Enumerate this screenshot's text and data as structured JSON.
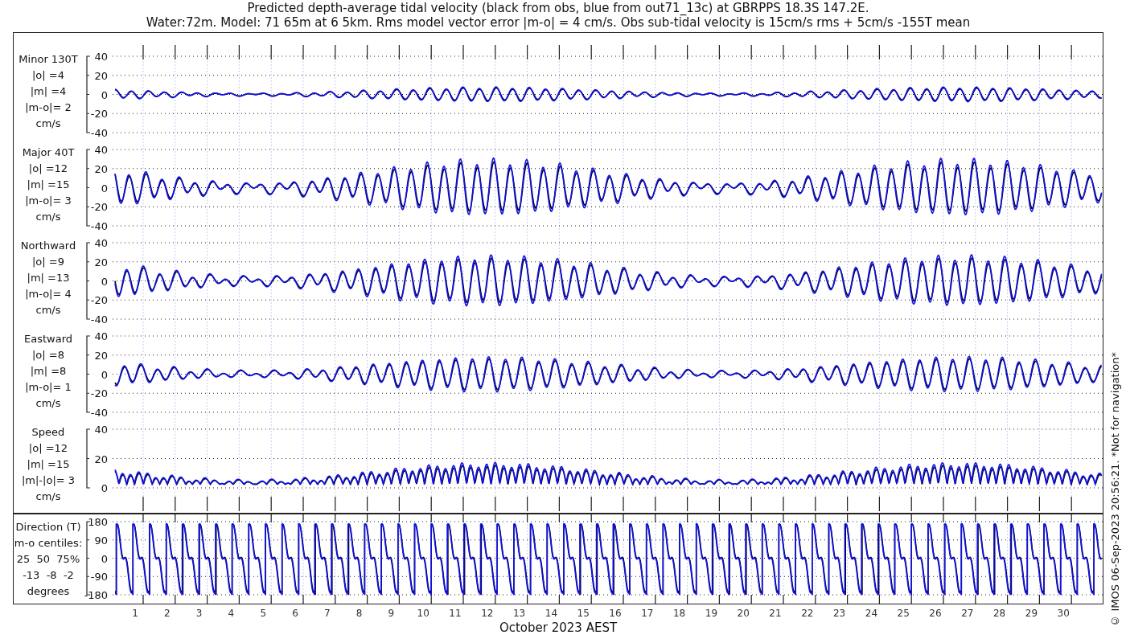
{
  "title": [
    "Predicted depth-average tidal velocity (black from obs, blue from out71_13c) at GBRPPS 18.3S 147.2E.",
    "Water:72m. Model: 71 65m at 6 5km. Rms model vector error |m-o| = 4 cm/s. Obs sub-tidal velocity is 15cm/s rms + 5cm/s -155T mean"
  ],
  "panels": [
    {
      "kind": "velocity",
      "label": [
        "Minor 130T",
        "|o| =4",
        "|m| =4",
        "|m-o|= 2",
        "cm/s"
      ],
      "yticks": [
        "40",
        "20",
        "0",
        "-20",
        "-40"
      ]
    },
    {
      "kind": "velocity",
      "label": [
        "Major 40T",
        "|o| =12",
        "|m| =15",
        "|m-o|= 3",
        "cm/s"
      ],
      "yticks": [
        "40",
        "20",
        "0",
        "-20",
        "-40"
      ]
    },
    {
      "kind": "velocity",
      "label": [
        "Northward",
        "|o| =9",
        "|m| =13",
        "|m-o|= 4",
        "cm/s"
      ],
      "yticks": [
        "40",
        "20",
        "0",
        "-20",
        "-40"
      ]
    },
    {
      "kind": "velocity",
      "label": [
        "Eastward",
        "|o| =8",
        "|m| =8",
        "|m-o|= 1",
        "cm/s"
      ],
      "yticks": [
        "40",
        "20",
        "0",
        "-20",
        "-40"
      ]
    },
    {
      "kind": "speed",
      "label": [
        "Speed",
        "|o| =12",
        "|m| =15",
        "|m|-|o|= 3",
        "cm/s"
      ],
      "yticks": [
        "40",
        "20",
        "0"
      ]
    }
  ],
  "direction": {
    "kind": "direction",
    "label": [
      "Direction (T)",
      "m-o centiles:",
      "25  50  75%",
      "-13  -8  -2",
      "degrees"
    ],
    "yticks": [
      "180",
      "90",
      "0",
      "-90",
      "-180"
    ]
  },
  "xticks": [
    "1",
    "2",
    "3",
    "4",
    "5",
    "6",
    "7",
    "8",
    "9",
    "10",
    "11",
    "12",
    "13",
    "14",
    "15",
    "16",
    "17",
    "18",
    "19",
    "20",
    "21",
    "22",
    "23",
    "24",
    "25",
    "26",
    "27",
    "28",
    "29",
    "30"
  ],
  "xlabel": "October 2023 AEST",
  "credit": "© IMOS 06-Sep-2023 20:56:21. *Not for navigation*"
}
